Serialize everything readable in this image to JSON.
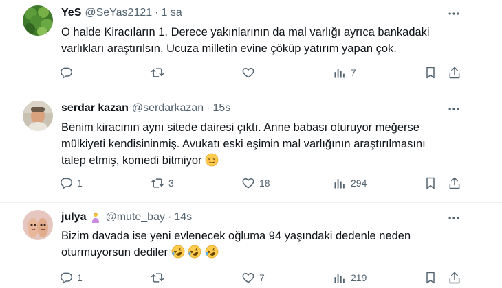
{
  "tweets": [
    {
      "name": "YeS",
      "handle": "@SeYas2121",
      "time": "1 sa",
      "text_lines": [
        "O halde Kiracıların 1. Derece yakınlarının da mal varlığı ayrıca bankadaki",
        "varlıkları araştırılsın. Ucuza  milletin evine çöküp yatırım yapan çok."
      ],
      "replies": "",
      "reposts": "",
      "likes": "",
      "views": "7"
    },
    {
      "name": "serdar kazan",
      "handle": "@serdarkazan",
      "time": "15s",
      "text_lines": [
        "Benim kiracının aynı sitede dairesi çıktı. Anne babası oturuyor meğerse",
        "mülkiyeti kendisininmiş. Avukatı eski eşimin mal varlığının araştırılmasını",
        "talep etmiş, komedi bitmiyor"
      ],
      "replies": "1",
      "reposts": "3",
      "likes": "18",
      "views": "294"
    },
    {
      "name": "julya",
      "handle": "@mute_bay",
      "time": "14s",
      "text_lines": [
        "Bizim davada ise yeni evlenecek oğluma 94 yaşındaki dedenle neden",
        "oturmuyorsun dediler"
      ],
      "replies": "1",
      "reposts": "",
      "likes": "7",
      "views": "219"
    }
  ],
  "icons": {
    "more": "more-horizontal-icon",
    "reply": "reply-icon",
    "repost": "repost-icon",
    "like": "like-icon",
    "views": "views-icon",
    "bookmark": "bookmark-icon",
    "share": "share-icon"
  },
  "colors": {
    "text": "#0f1419",
    "secondary": "#536471",
    "divider": "#eff3f4"
  }
}
